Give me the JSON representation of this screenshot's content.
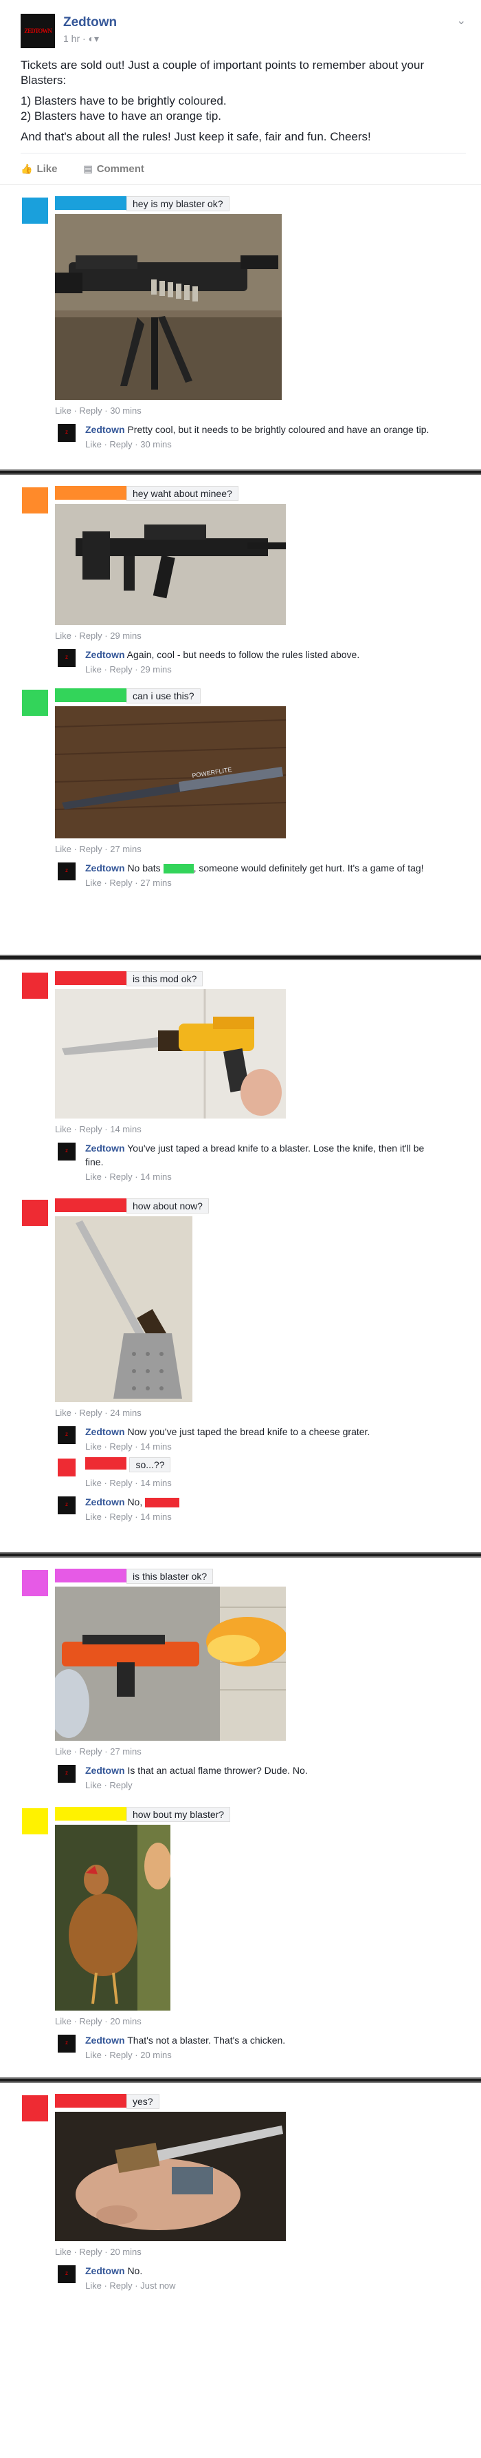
{
  "post": {
    "logo_text": "ZEDTOWN",
    "page_name": "Zedtown",
    "time": "1 hr · ",
    "audience_icon": "globe-icon",
    "body": [
      "Tickets are sold out! Just a couple of important points to remember about your Blasters:",
      "1) Blasters have to be brightly coloured.",
      "2) Blasters have to have an orange tip.",
      "And that's about all the rules! Just keep it safe, fair and fun. Cheers!"
    ],
    "like_label": "Like",
    "comment_label": "Comment"
  },
  "links": {
    "like": "Like",
    "reply": "Reply",
    "sep": " · "
  },
  "colors": {
    "blue": "#1aa0dc",
    "orange": "#ff8a2a",
    "green": "#33d45a",
    "red": "#ee2b33",
    "magenta": "#e65ae6",
    "yellow": "#fff200",
    "brand": "#365899"
  },
  "threads": [
    {
      "comments": [
        {
          "text": "hey is my blaster ok?",
          "image": "tripod-mounted-black-blaster",
          "time": "30 mins",
          "replies": [
            {
              "name": "Zedtown",
              "text": "Pretty cool, but it needs to be brightly coloured and have an orange tip.",
              "time": "30 mins"
            }
          ]
        }
      ]
    },
    {
      "comments": [
        {
          "text": "hey waht about minee?",
          "image": "black-assault-rifle",
          "time": "29 mins",
          "replies": [
            {
              "name": "Zedtown",
              "text": "Again, cool - but needs to follow the rules listed above.",
              "time": "29 mins"
            }
          ]
        },
        {
          "text": "can i use this?",
          "image": "baseball-bat-on-floor",
          "time": "27 mins",
          "replies": [
            {
              "name": "Zedtown",
              "text_before": "No bats",
              "text_after": ", someone would definitely get hurt. It's a game of tag!",
              "time": "27 mins"
            }
          ]
        }
      ]
    },
    {
      "comments": [
        {
          "text": "is this mod ok?",
          "image": "blaster-with-bread-knife",
          "time": "14 mins",
          "replies": [
            {
              "name": "Zedtown",
              "text": "You've just taped a bread knife to a blaster. Lose the knife, then it'll be fine.",
              "time": "14 mins"
            }
          ]
        },
        {
          "text": "how about now?",
          "image": "knife-taped-to-grater",
          "time": "24 mins",
          "replies": [
            {
              "name": "Zedtown",
              "text": "Now you've just taped the bread knife to a cheese grater.",
              "time": "14 mins"
            }
          ],
          "user_reply": {
            "text": "so...??",
            "time": "14 mins"
          },
          "final_reply": {
            "name": "Zedtown",
            "text": "No,",
            "time": "14 mins"
          }
        }
      ]
    },
    {
      "comments": [
        {
          "text": "is this blaster ok?",
          "image": "flamethrower-blaster",
          "time": "27 mins",
          "replies": [
            {
              "name": "Zedtown",
              "text": "Is that an actual flame thrower? Dude. No.",
              "time": ""
            }
          ]
        },
        {
          "text": "how bout my blaster?",
          "image": "chicken",
          "time": "20 mins",
          "replies": [
            {
              "name": "Zedtown",
              "text": "That's not a blaster. That's a chicken.",
              "time": "20 mins"
            }
          ]
        }
      ]
    },
    {
      "comments": [
        {
          "text": "yes?",
          "image": "hand-with-knife",
          "time": "20 mins",
          "replies": [
            {
              "name": "Zedtown",
              "text": "No.",
              "time": "Just now"
            }
          ]
        }
      ]
    }
  ]
}
